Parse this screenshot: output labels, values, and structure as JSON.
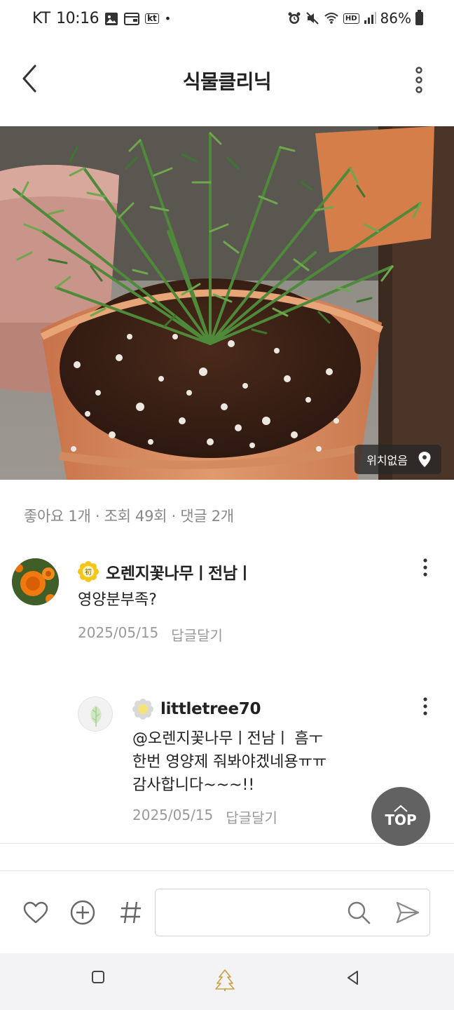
{
  "status_bar": {
    "carrier": "KT",
    "time": "10:16",
    "kt_badge": "kt",
    "hd": "HD",
    "battery": "86%"
  },
  "header": {
    "title": "식물클리닉"
  },
  "photo": {
    "location_label": "위치없음"
  },
  "stats": {
    "text": "좋아요 1개 · 조회 49회 · 댓글 2개"
  },
  "comments": [
    {
      "author": "오렌지꽃나무ㅣ전남ㅣ",
      "badge_char": "初",
      "text": "영양분부족?",
      "date": "2025/05/15",
      "reply_label": "답글달기"
    },
    {
      "author": "littletree70",
      "text_lines": [
        "@오렌지꽃나무ㅣ전남ㅣ 흠ㅜ",
        "한번 영양제 줘봐야겠네용ㅠㅠ",
        "감사합니다~~~!!"
      ],
      "date": "2025/05/15",
      "reply_label": "답글달기"
    }
  ],
  "top_button": {
    "label": "TOP"
  },
  "input_bar": {
    "placeholder": ""
  },
  "colors": {
    "accent_badge": "#f5c518",
    "avatar_orange": "#f07a10",
    "pot_terracotta": "#d98a5c"
  }
}
